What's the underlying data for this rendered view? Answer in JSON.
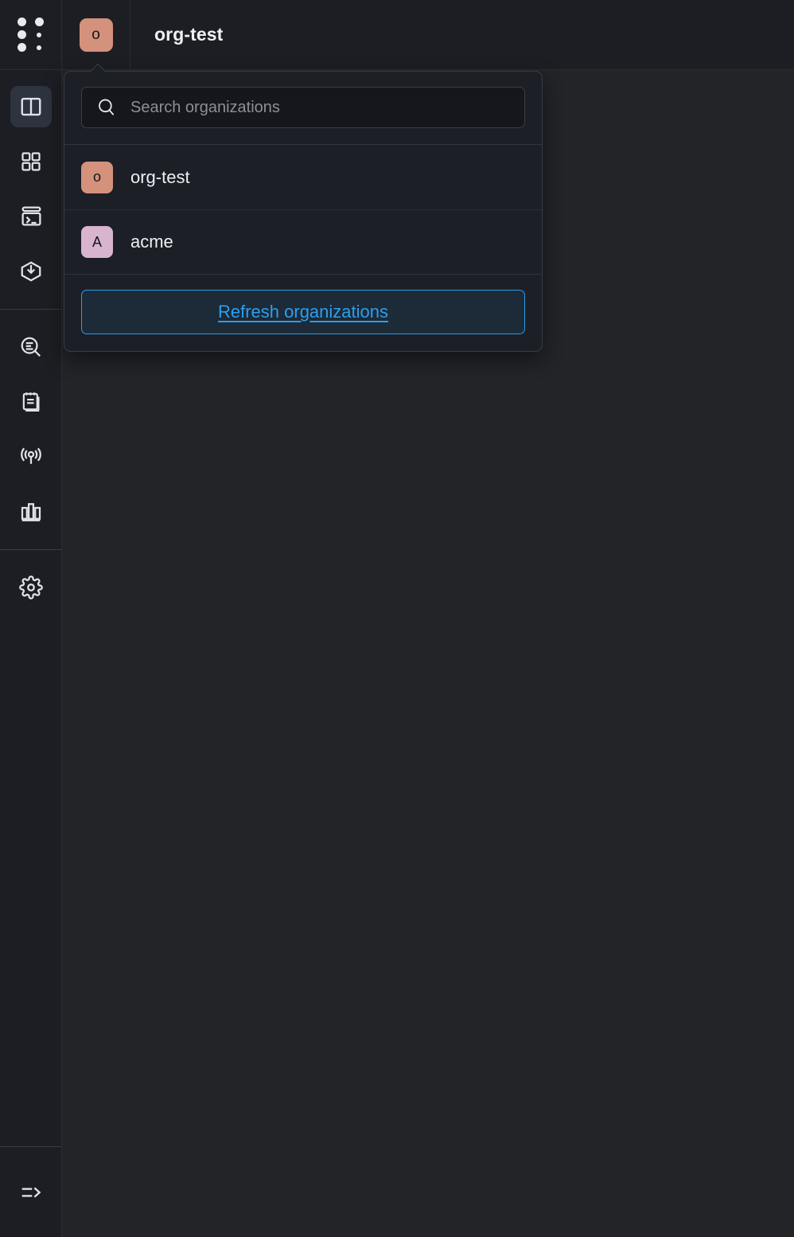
{
  "header": {
    "grip_icon": "drag-handle-icon",
    "org_avatar": {
      "letter": "o",
      "color": "#d4917c"
    },
    "title": "org-test"
  },
  "sidebar": {
    "groups": [
      {
        "items": [
          {
            "icon": "split-panel-icon",
            "name": "sidebar-item-panels",
            "active": true
          },
          {
            "icon": "grid-dashboard-icon",
            "name": "sidebar-item-dashboard",
            "active": false
          },
          {
            "icon": "terminal-icon",
            "name": "sidebar-item-terminal",
            "active": false
          },
          {
            "icon": "package-download-icon",
            "name": "sidebar-item-deploys",
            "active": false
          }
        ]
      },
      {
        "items": [
          {
            "icon": "search-inspect-icon",
            "name": "sidebar-item-explore",
            "active": false
          },
          {
            "icon": "notepad-icon",
            "name": "sidebar-item-notes",
            "active": false
          },
          {
            "icon": "broadcast-icon",
            "name": "sidebar-item-live",
            "active": false
          },
          {
            "icon": "bar-chart-icon",
            "name": "sidebar-item-metrics",
            "active": false
          }
        ]
      },
      {
        "items": [
          {
            "icon": "gear-icon",
            "name": "sidebar-item-settings",
            "active": false
          }
        ]
      }
    ],
    "collapse_icon": "expand-sidebar-icon"
  },
  "dropdown": {
    "search": {
      "placeholder": "Search organizations",
      "value": "",
      "icon": "search-icon"
    },
    "organizations": [
      {
        "letter": "o",
        "name": "org-test",
        "color": "#d4917c"
      },
      {
        "letter": "A",
        "name": "acme",
        "color": "#d9b4ce"
      }
    ],
    "refresh_label": "Refresh organizations"
  },
  "colors": {
    "page_bg": "#232428",
    "panel_bg": "#1c1f26",
    "rail_bg": "#1c1e23",
    "accent_blue": "#2b9ff0",
    "border": "#3a3d46"
  }
}
